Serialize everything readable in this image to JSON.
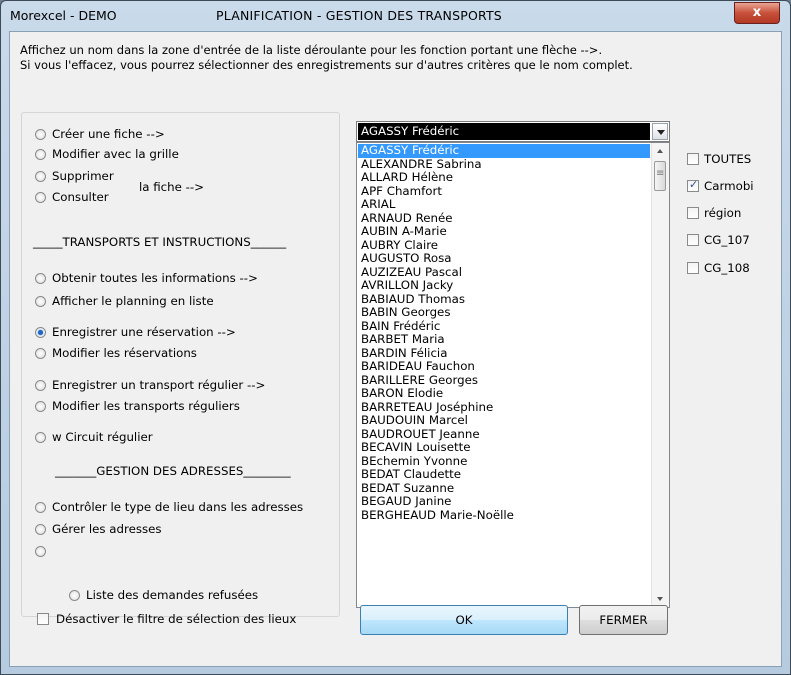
{
  "window": {
    "app_title": "Morexcel - DEMO",
    "center_title": "PLANIFICATION  -  GESTION DES TRANSPORTS",
    "close_glyph": "x"
  },
  "intro": {
    "line1": "Affichez un nom dans la zone d'entrée de la liste déroulante pour les fonction portant une flèche  -->.",
    "line2": "Si vous l'effacez, vous pourrez sélectionner des enregistrements sur d'autres critères que le nom complet."
  },
  "options": {
    "creer": "Créer une fiche  -->",
    "modifier_grille": "Modifier avec la grille",
    "supprimer": "Supprimer",
    "consulter": "Consulter",
    "la_fiche": "la fiche  -->",
    "sep_transports": "_____TRANSPORTS ET INSTRUCTIONS______",
    "obtenir": "Obtenir toutes les informations -->",
    "afficher_planning": "Afficher le planning en liste",
    "enregistrer_reservation": "Enregistrer une réservation -->",
    "modifier_reservations": "Modifier les réservations",
    "enregistrer_transport": "Enregistrer un transport régulier -->",
    "modifier_transports": "Modifier les transports réguliers",
    "circuit": "w Circuit régulier",
    "sep_adresses": "_______GESTION DES ADRESSES________",
    "controler": "Contrôler le type de lieu dans les adresses",
    "gerer": "Gérer les adresses",
    "liste_refusees": "Liste des demandes refusées",
    "selected": "enregistrer_reservation"
  },
  "combo": {
    "value": "AGASSY Frédéric"
  },
  "list": {
    "items": [
      "AGASSY Frédéric",
      "ALEXANDRE Sabrina",
      "ALLARD Hélène",
      "APF Chamfort",
      "ARIAL",
      "ARNAUD Renée",
      "AUBIN A-Marie",
      "AUBRY Claire",
      "AUGUSTO Rosa",
      "AUZIZEAU Pascal",
      "AVRILLON Jacky",
      "BABIAUD Thomas",
      "BABIN Georges",
      "BAIN Frédéric",
      "BARBET Maria",
      "BARDIN Félicia",
      "BARIDEAU Fauchon",
      "BARILLERE Georges",
      "BARON Elodie",
      "BARRETEAU Joséphine",
      "BAUDOUIN Marcel",
      "BAUDROUET Jeanne",
      "BECAVIN Louisette",
      "BEchemin Yvonne",
      "BEDAT Claudette",
      "BEDAT Suzanne",
      "BEGAUD Janine",
      "BERGHEAUD Marie-Noëlle"
    ],
    "selected_index": 0
  },
  "filters": {
    "toutes": "TOUTES",
    "carmobi": "Carmobi",
    "region": "région",
    "cg107": "CG_107",
    "cg108": "CG_108",
    "checked": [
      "carmobi"
    ]
  },
  "bottom": {
    "desactiver": "Désactiver le filtre de sélection des lieux",
    "ok": "OK",
    "fermer": "FERMER"
  },
  "colors": {
    "list_highlight": "#3399ff",
    "title_close": "#c8503a",
    "ok_button": "#bee6fd"
  }
}
